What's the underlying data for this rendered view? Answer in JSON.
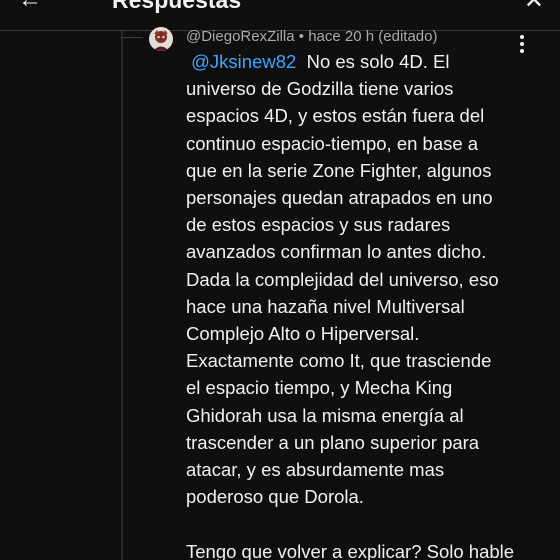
{
  "header": {
    "back_icon": "arrow-left-icon",
    "title": "Respuestas",
    "close_icon": "close-icon"
  },
  "comment": {
    "author": "@DiegoRexZilla",
    "separator": "•",
    "time": "hace 20 h",
    "edited": "(editado)",
    "mention": "@Jksinew82",
    "menu_icon": "more-vertical-icon",
    "lines": [
      "No es solo 4D. El",
      "universo de Godzilla tiene varios",
      "espacios 4D, y estos están fuera del",
      "continuo espacio-tiempo, en base a",
      "que en la serie Zone Fighter, algunos",
      "personajes quedan atrapados en uno",
      "de estos espacios y sus radares",
      "avanzados confirman lo antes dicho.",
      "Dada la complejidad del universo, eso",
      "hace una hazaña nivel Multiversal",
      "Complejo Alto o Hiperversal.",
      "Exactamente como It, que trasciende",
      "el espacio tiempo, y Mecha King",
      "Ghidorah usa la misma energía al",
      "trascender a un plano superior para",
      "atacar, y es absurdamente mas",
      "poderoso que Dorola."
    ],
    "trailing_line": "Tengo que volver a explicar? Solo hable"
  },
  "colors": {
    "background": "#0f0f0f",
    "text": "#f1f1f1",
    "secondary_text": "#aaaaaa",
    "mention": "#3ea6ff"
  }
}
